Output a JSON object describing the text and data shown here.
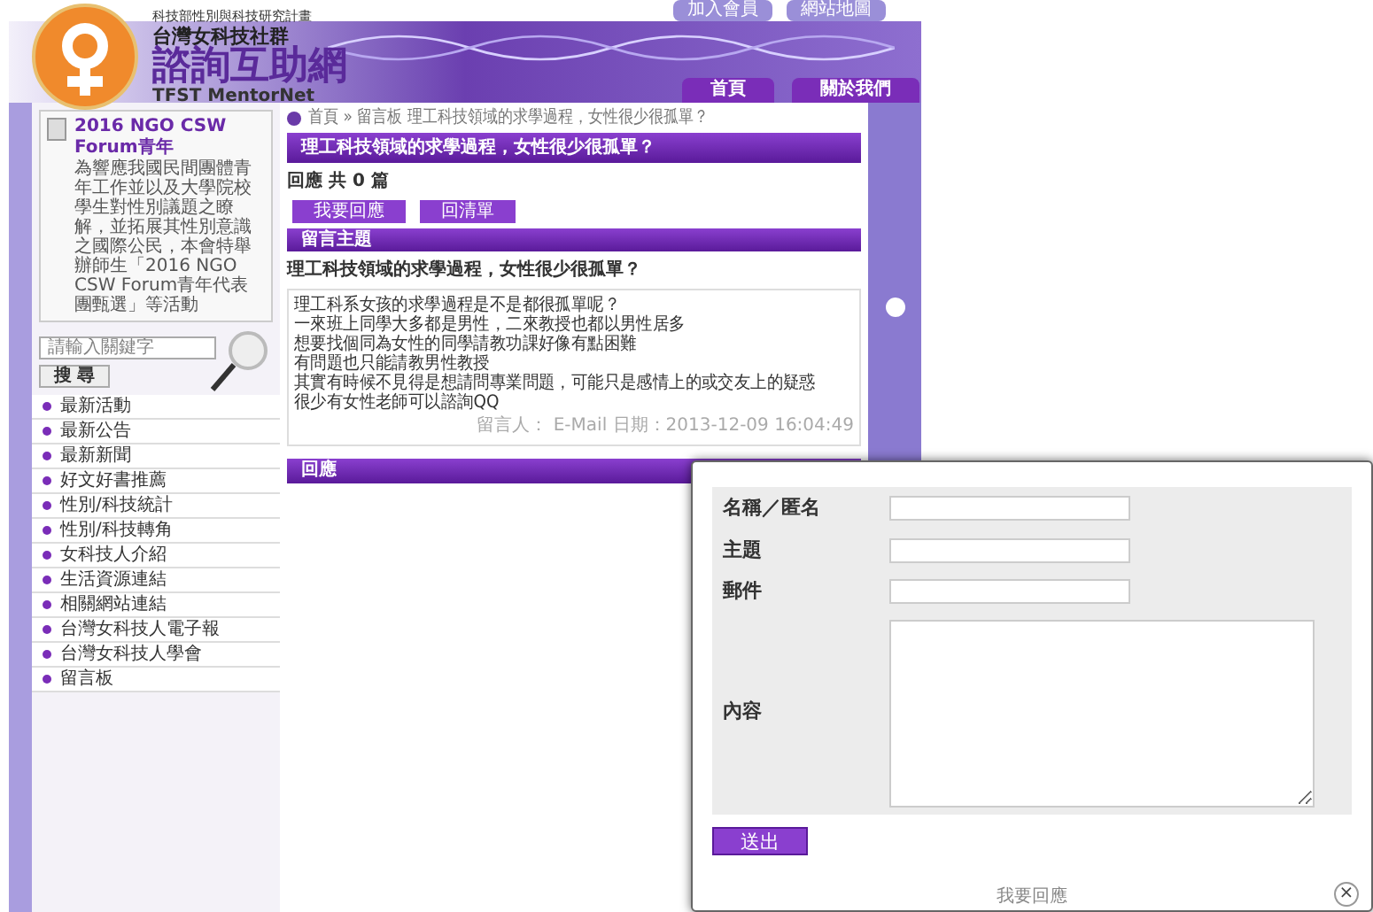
{
  "header": {
    "top_links": [
      "加入會員",
      "網站地圖"
    ],
    "logo": {
      "tagline": "科技部性別與科技研究計畫",
      "org": "台灣女科技社群",
      "title": "諮詢互助網",
      "subtitle": "TFST MentorNet"
    },
    "nav": [
      "首頁",
      "關於我們"
    ]
  },
  "sidebar": {
    "news": {
      "title": "2016 NGO CSW Forum青年",
      "summary": "為響應我國民間團體青年工作並以及大學院校學生對性別議題之瞭解，並拓展其性別意識之國際公民，本會特舉辦師生「2016 NGO CSW Forum青年代表團甄選」等活動"
    },
    "search": {
      "placeholder": "請輸入關鍵字",
      "button": "搜 尋"
    },
    "menu": [
      "最新活動",
      "最新公告",
      "最新新聞",
      "好文好書推薦",
      "性別/科技統計",
      "性別/科技轉角",
      "女科技人介紹",
      "生活資源連結",
      "相關網站連結",
      "台灣女科技人電子報",
      "台灣女科技人學會",
      "留言板"
    ]
  },
  "main": {
    "breadcrumb": "首頁 » 留言板 理工科技領域的求學過程，女性很少很孤單？",
    "title": "理工科技領域的求學過程，女性很少很孤單？",
    "reply_count": "回應 共 0 篇",
    "buttons": [
      "我要回應",
      "回清單"
    ],
    "topic_header": "留言主題",
    "topic_title": "理工科技領域的求學過程，女性很少很孤單？",
    "body_lines": [
      "理工科系女孩的求學過程是不是都很孤單呢？",
      "一來班上同學大多都是男性，二來教授也都以男性居多",
      "想要找個同為女性的同學請教功課好像有點困難",
      "有問題也只能請教男性教授",
      "其實有時候不見得是想請問專業問題，可能只是感情上的或交友上的疑惑",
      "很少有女性老師可以諮詢QQ"
    ],
    "meta": "留言人： E-Mail 日期：2013-12-09 16:04:49",
    "replies_header": "回應"
  },
  "dialog": {
    "fields": [
      {
        "label": "名稱／匿名",
        "kind": "input"
      },
      {
        "label": "主題",
        "kind": "input"
      },
      {
        "label": "郵件",
        "kind": "input"
      },
      {
        "label": "內容",
        "kind": "textarea"
      }
    ],
    "submit": "送出",
    "title": "我要回應",
    "close": "×"
  }
}
